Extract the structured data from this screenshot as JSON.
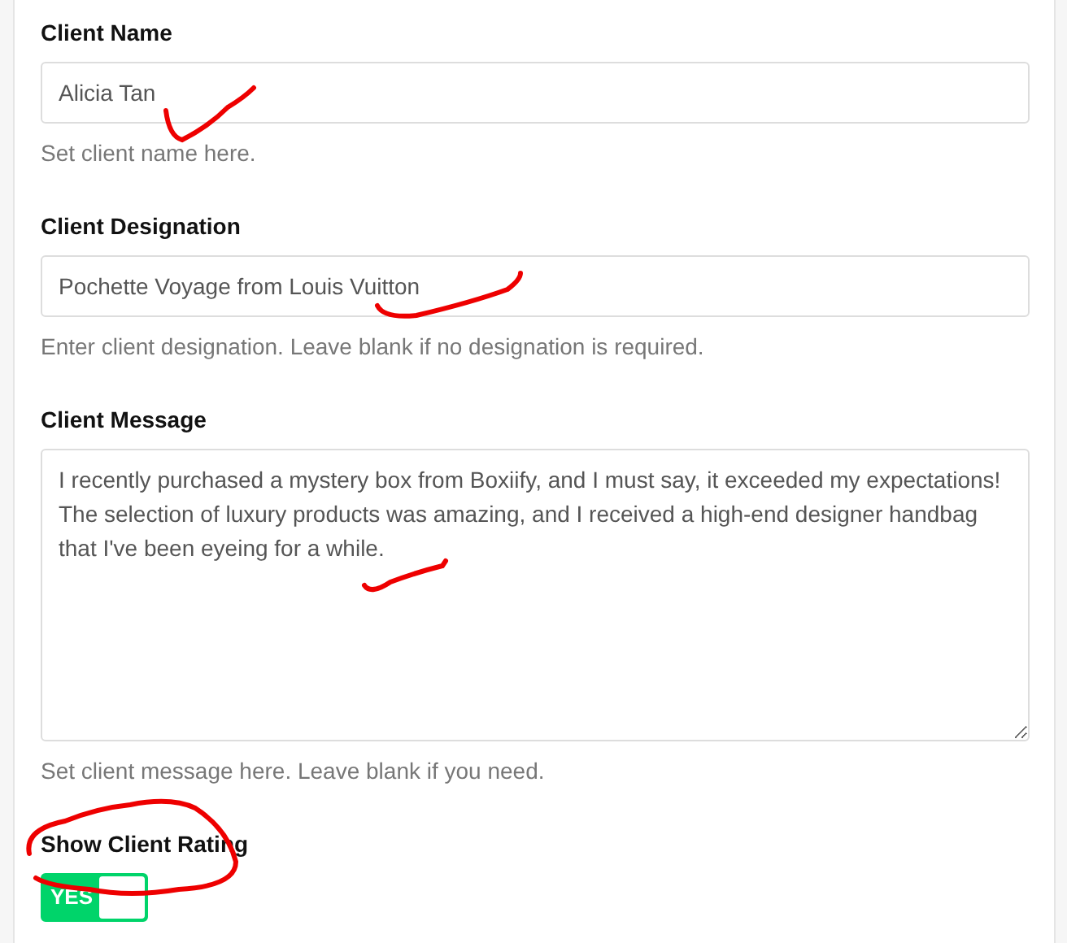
{
  "fields": [
    {
      "kind": "input",
      "label": "Client Name",
      "value": "Alicia Tan",
      "help": "Set client name here."
    },
    {
      "kind": "input",
      "label": "Client Designation",
      "value": "Pochette Voyage from Louis Vuitton",
      "help": "Enter client designation. Leave blank if no designation is required."
    },
    {
      "kind": "textarea",
      "label": "Client Message",
      "value": "I recently purchased a mystery box from Boxiify, and I must say, it exceeded my expectations! The selection of luxury products was amazing, and I received a high-end designer handbag that I've been eyeing for a while.",
      "help": "Set client message here. Leave blank if you need."
    },
    {
      "kind": "toggle",
      "label": "Show Client Rating",
      "on": true,
      "state_text": "YES"
    }
  ]
}
